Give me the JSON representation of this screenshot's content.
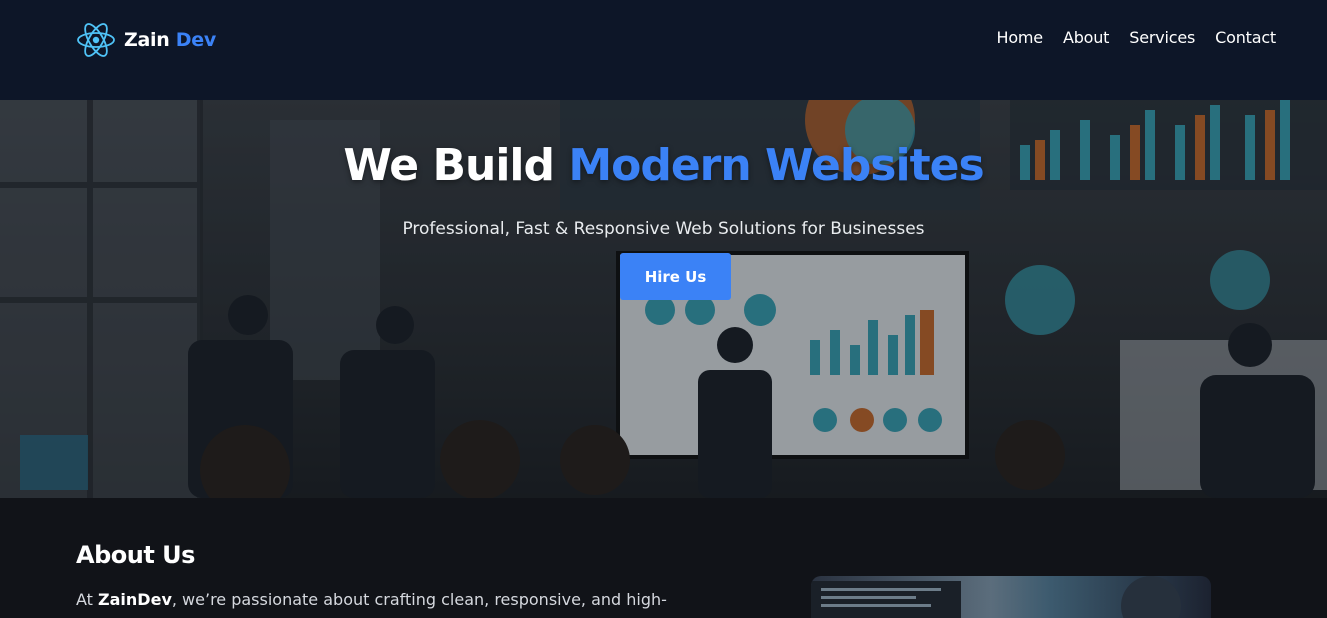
{
  "brand": {
    "name_part1": "Zain",
    "name_part2": "Dev"
  },
  "nav": {
    "items": [
      "Home",
      "About",
      "Services",
      "Contact"
    ]
  },
  "hero": {
    "title_part1": "We Build",
    "title_part2": "Modern Websites",
    "subtitle": "Professional, Fast & Responsive Web Solutions for Businesses",
    "cta_label": "Hire Us"
  },
  "about": {
    "title": "About Us",
    "text_prefix": "At ",
    "text_brand": "ZainDev",
    "text_rest": ", we’re passionate about crafting clean, responsive, and high-"
  },
  "colors": {
    "accent": "#3b82f6",
    "header_bg": "#0d1628",
    "page_bg": "#111318"
  },
  "icons": {
    "logo": "react-atom-icon"
  }
}
